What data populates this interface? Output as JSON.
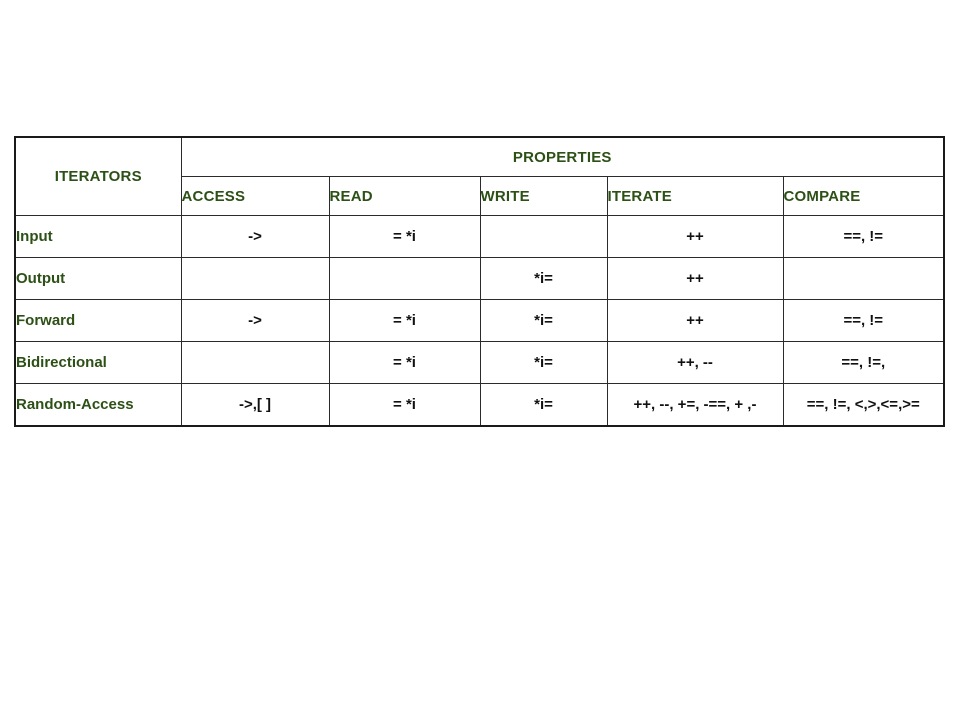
{
  "table": {
    "corner_header": "ITERATORS",
    "group_header": "PROPERTIES",
    "property_columns": [
      "ACCESS",
      "READ",
      "WRITE",
      "ITERATE",
      "COMPARE"
    ],
    "rows": [
      {
        "label": "Input",
        "access": "->",
        "read": "= *i",
        "write": "",
        "iterate": "++",
        "compare": "==, !="
      },
      {
        "label": "Output",
        "access": "",
        "read": "",
        "write": "*i=",
        "iterate": "++",
        "compare": ""
      },
      {
        "label": "Forward",
        "access": "->",
        "read": "= *i",
        "write": "*i=",
        "iterate": "++",
        "compare": "==, !="
      },
      {
        "label": "Bidirectional",
        "access": "",
        "read": "= *i",
        "write": "*i=",
        "iterate": "++, --",
        "compare": "==, !=,"
      },
      {
        "label": "Random-Access",
        "access": "->,[ ]",
        "read": "= *i",
        "write": "*i=",
        "iterate": "++, --, +=, -==, + ,-",
        "compare": "==, !=, <,>,<=,>="
      }
    ]
  },
  "colors": {
    "header_text": "#2d5016",
    "body_text": "#111111",
    "border": "#1a1a1a",
    "background": "#ffffff"
  }
}
